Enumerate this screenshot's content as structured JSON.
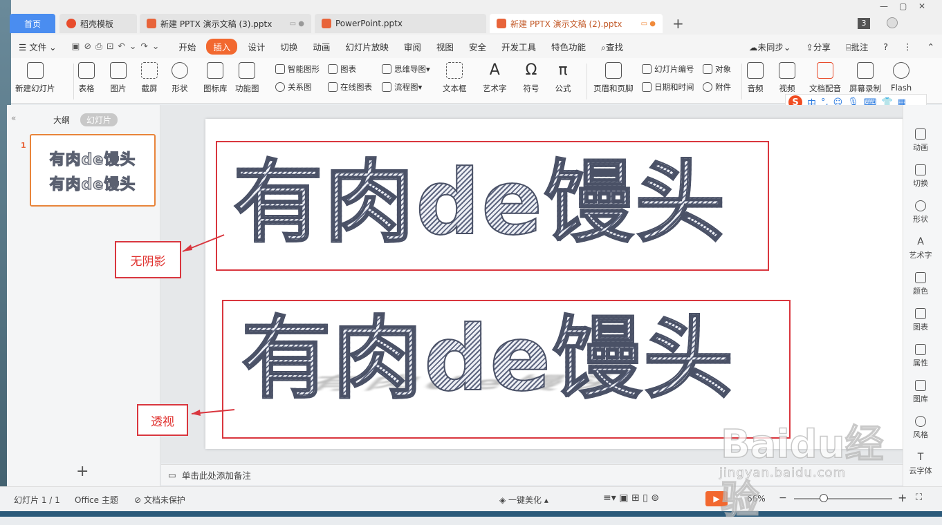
{
  "tabs": [
    {
      "label": "首页",
      "type": "home"
    },
    {
      "label": "稻壳模板",
      "type": "normal"
    },
    {
      "label": "新建 PPTX 演示文稿 (3).pptx",
      "type": "normal"
    },
    {
      "label": "PowerPoint.pptx",
      "type": "normal"
    },
    {
      "label": "新建 PPTX 演示文稿 (2).pptx",
      "type": "active"
    }
  ],
  "tab_badge": "3",
  "menu": {
    "file": "文件",
    "items": [
      "开始",
      "插入",
      "设计",
      "切换",
      "动画",
      "幻灯片放映",
      "审阅",
      "视图",
      "安全",
      "开发工具",
      "特色功能"
    ],
    "selected": "插入",
    "search": "查找",
    "sync": "未同步",
    "share": "分享",
    "comment": "批注"
  },
  "ribbon": {
    "new_slide": "新建幻灯片",
    "table": "表格",
    "picture": "图片",
    "screenshot": "截屏",
    "shape": "形状",
    "icon_lib": "图标库",
    "func_chart": "功能图",
    "smart_shape": "智能图形",
    "relation": "关系图",
    "chart": "图表",
    "online_chart": "在线图表",
    "mindmap": "思维导图",
    "flowchart": "流程图",
    "textbox": "文本框",
    "art_text": "艺术字",
    "symbol": "符号",
    "formula": "公式",
    "header_footer": "页眉和页脚",
    "slide_number": "幻灯片编号",
    "datetime": "日期和时间",
    "object": "对象",
    "attachment": "附件",
    "audio": "音频",
    "video": "视频",
    "doc_voice": "文档配音",
    "screen_record": "屏幕录制",
    "flash": "Flash"
  },
  "sogou": {
    "lang": "中",
    "punct": "°,"
  },
  "left_panel": {
    "outline": "大纲",
    "slides": "幻灯片",
    "slide_num": "1",
    "thumb_line1": "有肉de馒头",
    "thumb_line2": "有肉de馒头",
    "add": "+"
  },
  "slide": {
    "text1": "有肉de馒头",
    "text2": "有肉de馒头",
    "callout1": "无阴影",
    "callout2": "透视"
  },
  "right_sidebar": [
    "动画",
    "切换",
    "形状",
    "艺术字",
    "颜色",
    "图表",
    "属性",
    "图库",
    "风格",
    "云字体"
  ],
  "notes": "单击此处添加备注",
  "status": {
    "slide_info": "幻灯片 1 / 1",
    "theme": "Office 主题",
    "protect": "文档未保护",
    "beautify": "一键美化",
    "zoom": "66%"
  },
  "watermark": {
    "brand": "Baidu经验",
    "url": "jingyan.baidu.com"
  }
}
